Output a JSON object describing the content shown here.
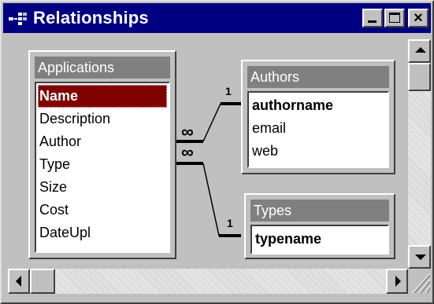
{
  "window": {
    "title": "Relationships"
  },
  "tables": {
    "applications": {
      "name": "Applications",
      "fields": [
        "Name",
        "Description",
        "Author",
        "Type",
        "Size",
        "Cost",
        "DateUpl"
      ]
    },
    "authors": {
      "name": "Authors",
      "fields": [
        "authorname",
        "email",
        "web"
      ]
    },
    "types": {
      "name": "Types",
      "fields": [
        "typename"
      ]
    }
  },
  "relationships": [
    {
      "from": "Applications.Author",
      "to": "Authors.authorname",
      "one_label": "1",
      "many_label": "∞"
    },
    {
      "from": "Applications.Type",
      "to": "Types.typename",
      "one_label": "1",
      "many_label": "∞"
    }
  ],
  "selected_field": "Name",
  "colors": {
    "titlebar": "#000080",
    "selection": "#800000",
    "face": "#c0c0c0"
  }
}
